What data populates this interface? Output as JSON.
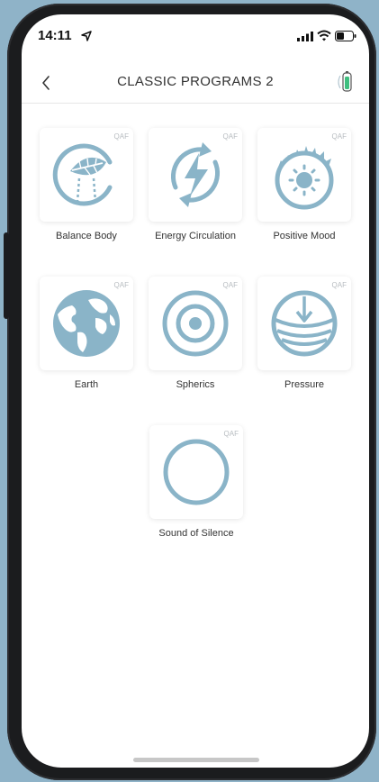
{
  "status_bar": {
    "time": "14:11"
  },
  "header": {
    "title": "CLASSIC PROGRAMS 2"
  },
  "programs": [
    {
      "label": "Balance Body",
      "badge": "QAF",
      "icon": "leaf-balance-icon"
    },
    {
      "label": "Energy Circulation",
      "badge": "QAF",
      "icon": "lightning-cycle-icon"
    },
    {
      "label": "Positive Mood",
      "badge": "QAF",
      "icon": "sun-icon"
    },
    {
      "label": "Earth",
      "badge": "QAF",
      "icon": "globe-icon"
    },
    {
      "label": "Spherics",
      "badge": "QAF",
      "icon": "concentric-circles-icon"
    },
    {
      "label": "Pressure",
      "badge": "QAF",
      "icon": "pressure-arrow-icon"
    },
    {
      "label": "Sound of Silence",
      "badge": "QAF",
      "icon": "ring-icon"
    }
  ],
  "colors": {
    "icon": "#8ab4c8",
    "background": "#8fb3c8",
    "battery_accent": "#3fbf7f"
  }
}
